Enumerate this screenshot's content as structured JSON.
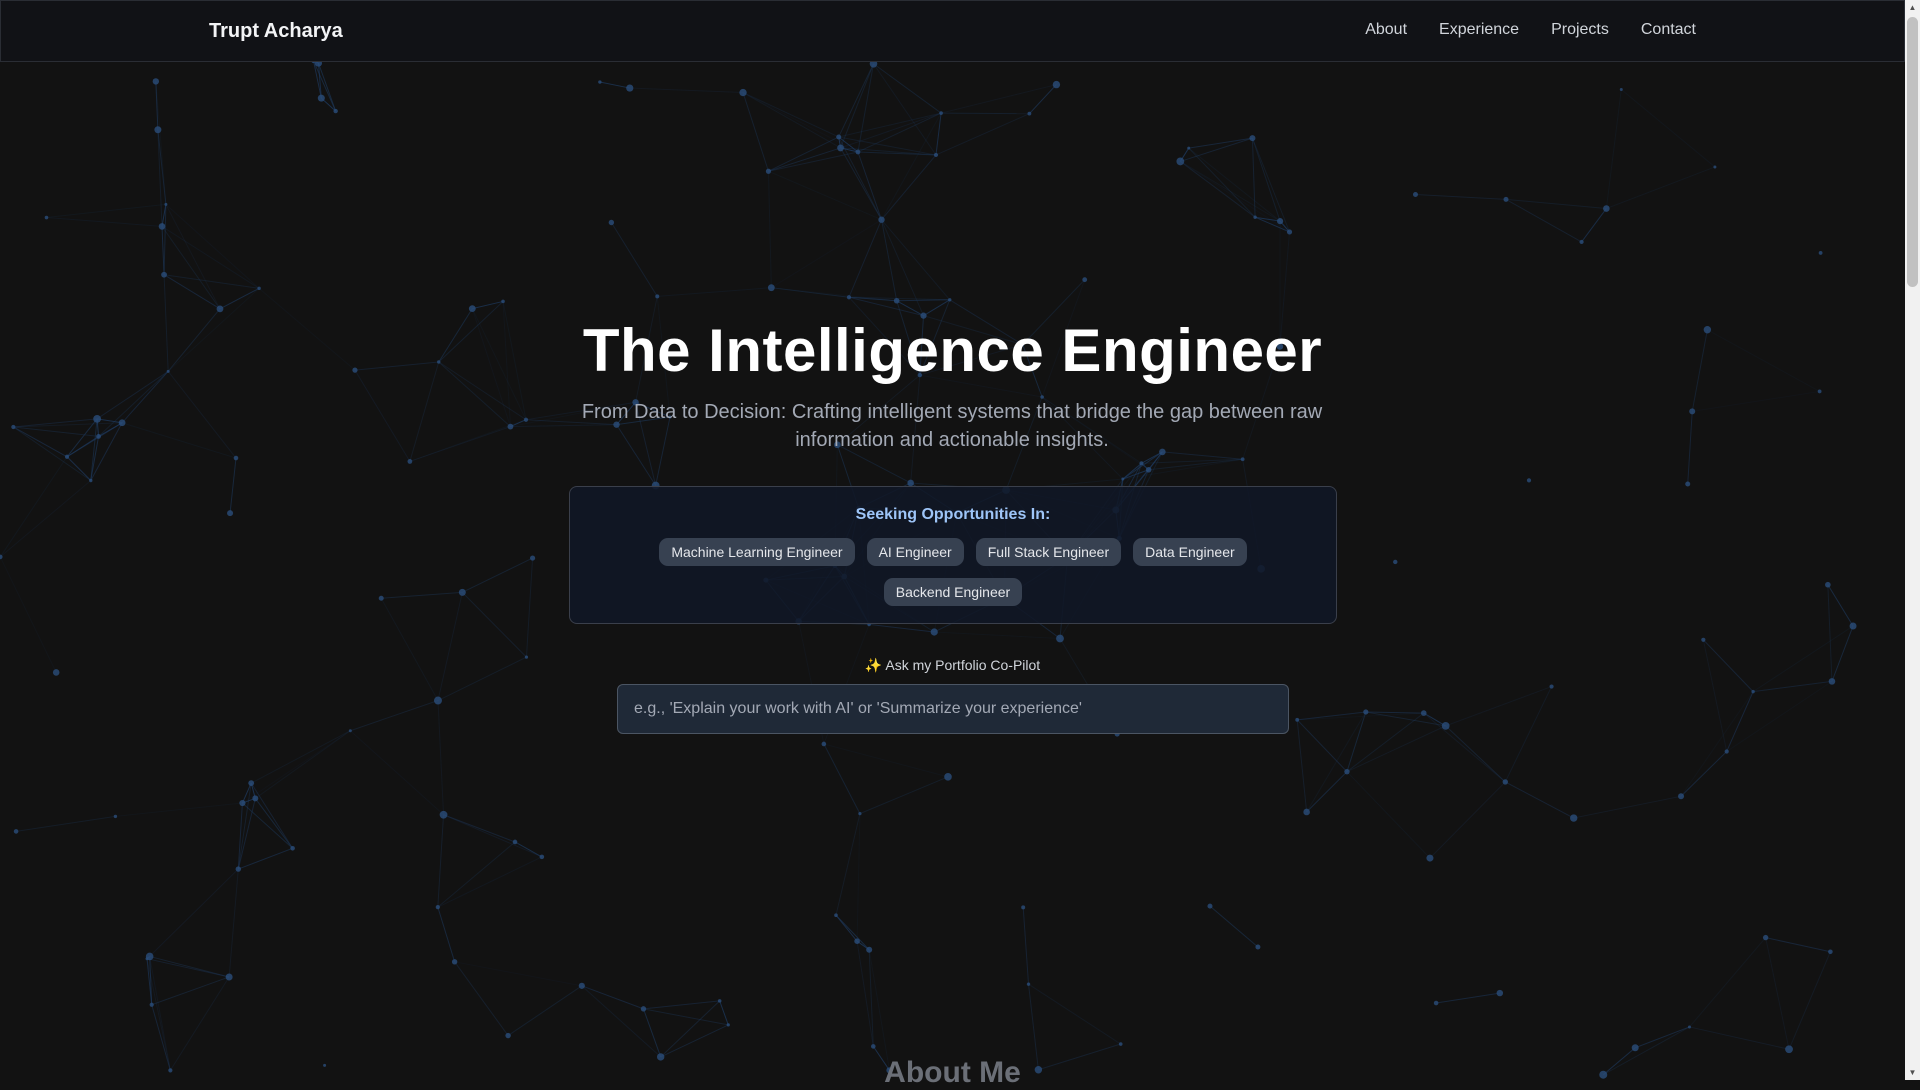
{
  "nav": {
    "brand": "Trupt Acharya",
    "links": [
      "About",
      "Experience",
      "Projects",
      "Contact"
    ]
  },
  "hero": {
    "title": "The Intelligence Engineer",
    "subtitle": "From Data to Decision: Crafting intelligent systems that bridge the gap between raw information and actionable insights."
  },
  "opportunities": {
    "heading": "Seeking Opportunities In:",
    "roles": [
      "Machine Learning Engineer",
      "AI Engineer",
      "Full Stack Engineer",
      "Data Engineer",
      "Backend Engineer"
    ]
  },
  "copilot": {
    "label": "✨ Ask my Portfolio Co-Pilot",
    "placeholder": "e.g., 'Explain your work with AI' or 'Summarize your experience'",
    "value": ""
  },
  "about": {
    "heading": "About Me"
  },
  "colors": {
    "background": "#121212",
    "accent": "#9ec5f8",
    "tag_bg": "#374151",
    "network_line": "#1e3a5f"
  },
  "icons": {
    "background": "network-mesh-icon",
    "copilot": "sparkles-icon"
  }
}
